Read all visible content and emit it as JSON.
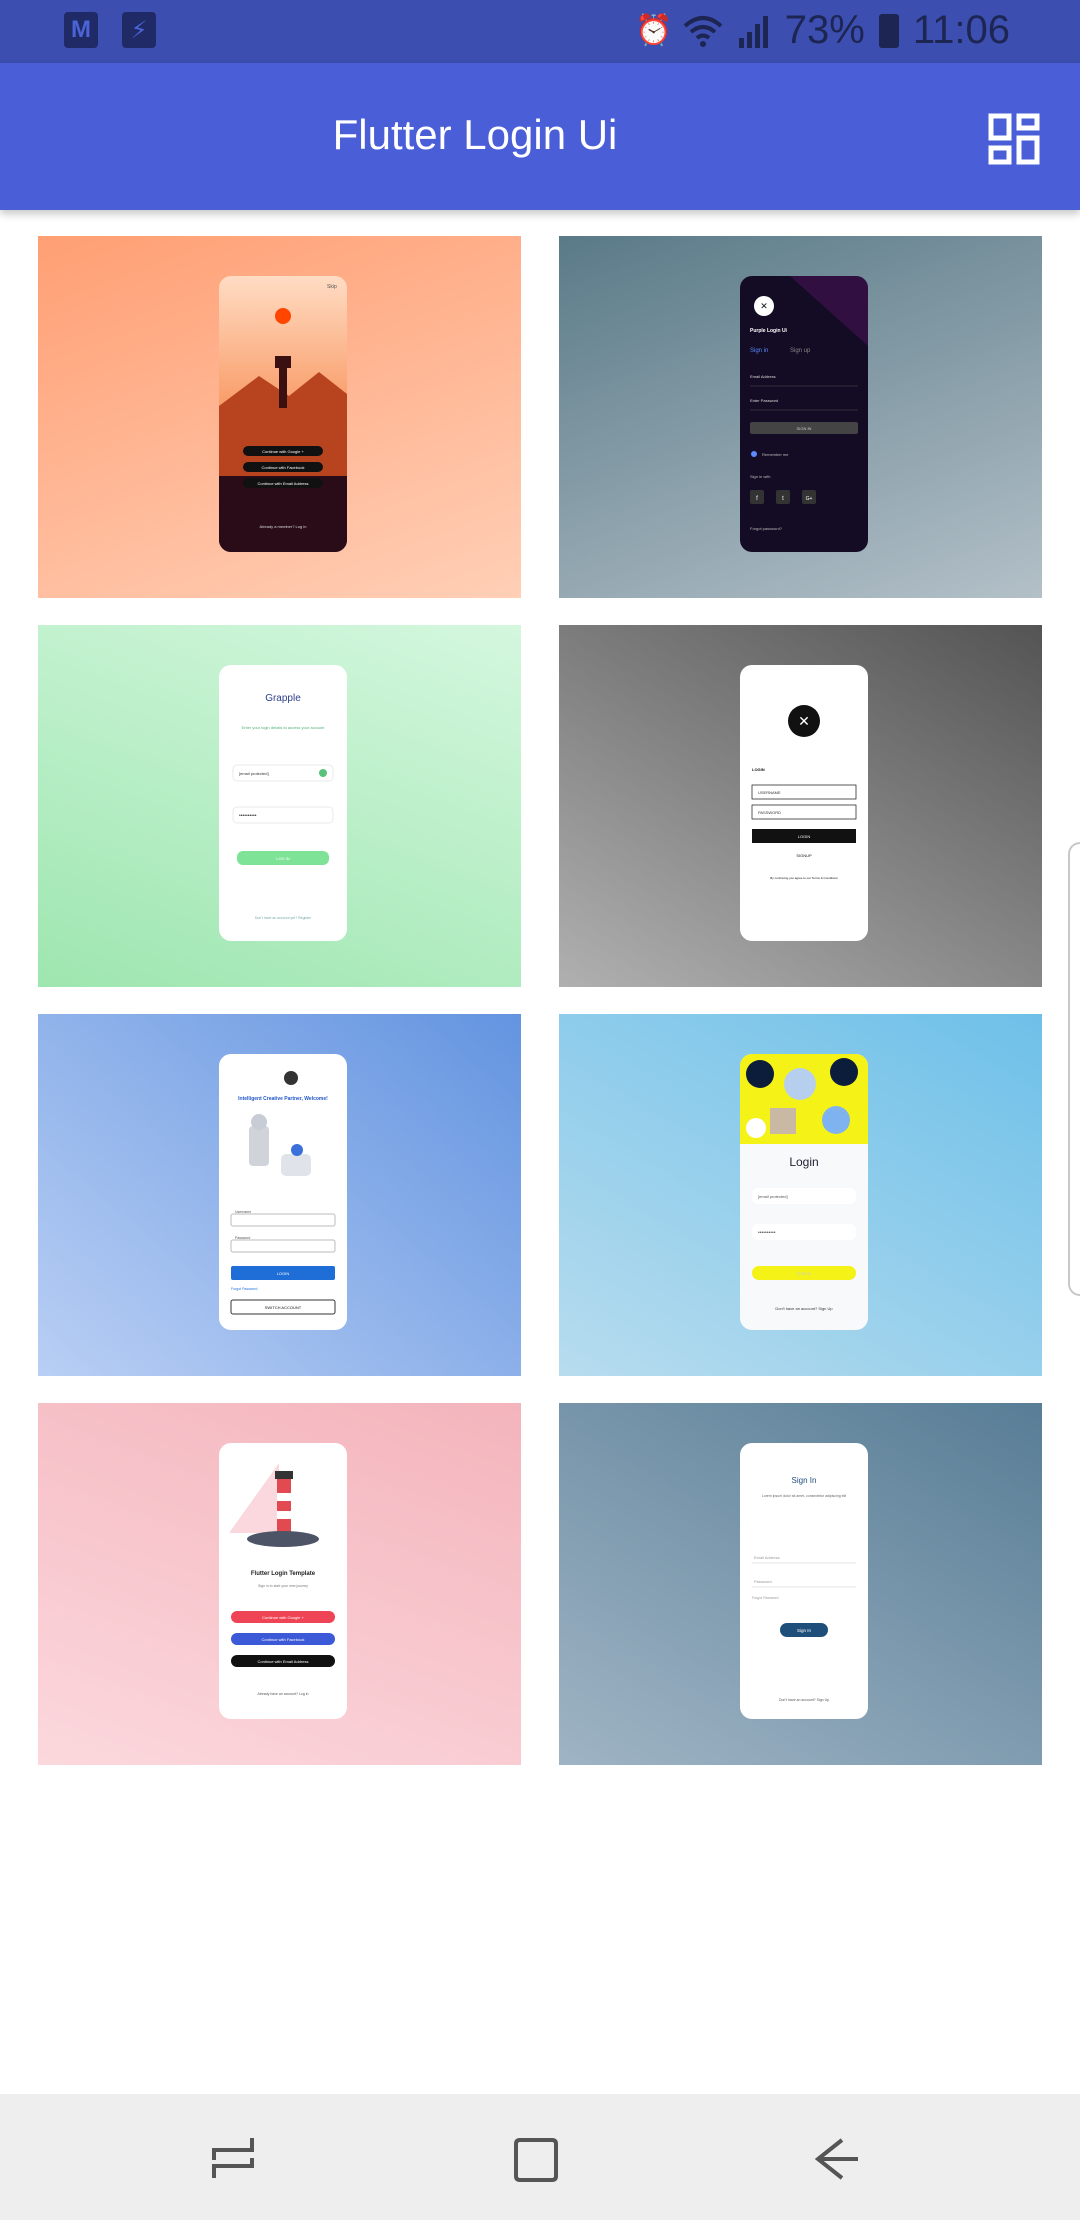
{
  "status_bar": {
    "battery_percent": "73%",
    "time": "11:06",
    "left_icons": [
      "gmail-icon",
      "usb-icon"
    ],
    "right_icons": [
      "alarm-icon",
      "wifi-icon",
      "signal-icon",
      "battery-icon"
    ]
  },
  "app_bar": {
    "title": "Flutter Login Ui",
    "action_icon": "dashboard-icon"
  },
  "cards": [
    {
      "name": "login-ui-card-1",
      "skip": "Skip",
      "buttons": [
        "Continue with Google +",
        "Continue with Facebook",
        "Continue with Email Address"
      ],
      "footer": "Already a member? Log in"
    },
    {
      "name": "login-ui-card-2",
      "title": "Purple Login Ui",
      "tabs": [
        "Sign in",
        "Sign up"
      ],
      "email_label": "Email Address",
      "password_label": "Enter Password",
      "sign_in": "SIGN IN",
      "remember": "Remember me",
      "sign_in_with": "Sign in with",
      "social": [
        "f",
        "t",
        "G+"
      ],
      "forgot": "Forgot password?"
    },
    {
      "name": "login-ui-card-3",
      "title": "Grapple",
      "subtitle": "Enter your login details to access your account",
      "email": "[email protected]",
      "password": "••••••••••",
      "button": "LOG IN",
      "footer": "Don't have an account yet? Register"
    },
    {
      "name": "login-ui-card-4",
      "section": "LOGIN",
      "username": "USERNAME",
      "password": "PASSWORD",
      "button": "LOGIN",
      "signup": "SIGNUP",
      "terms": "By continuing you agree to our Terms & Conditions"
    },
    {
      "name": "login-ui-card-5",
      "title": "Intelligent Creative Partner, Welcome!",
      "username_label": "Username",
      "password_label": "Password",
      "button": "LOGIN",
      "forgot": "Forgot Password",
      "switch": "SWITCH ACCOUNT"
    },
    {
      "name": "login-ui-card-6",
      "title": "Login",
      "email": "[email protected]",
      "password": "••••••••••",
      "button": "SIGN IN",
      "footer": "Don't have an account? Sign Up"
    },
    {
      "name": "login-ui-card-7",
      "title": "Flutter Login Template",
      "subtitle": "Sign in to start your new journey",
      "buttons": [
        "Continue with Google +",
        "Continue with Facebook",
        "Continue with Email Address"
      ],
      "footer": "Already have an account? Log in"
    },
    {
      "name": "login-ui-card-8",
      "title": "Sign In",
      "subtitle": "Lorem ipsum dolor sit amet, consectetur adipiscing elit",
      "email": "Email Address",
      "password": "Password",
      "forgot": "Forgot Password",
      "button": "Sign In",
      "footer": "Don't have an account? Sign Up"
    }
  ],
  "nav_bar": {
    "icons": [
      "recents-icon",
      "home-icon",
      "back-icon"
    ]
  },
  "colors": {
    "app_bar": "#4a5ed8",
    "status_bar": "#3c4fb0",
    "nav_bar": "#eeeeee"
  }
}
